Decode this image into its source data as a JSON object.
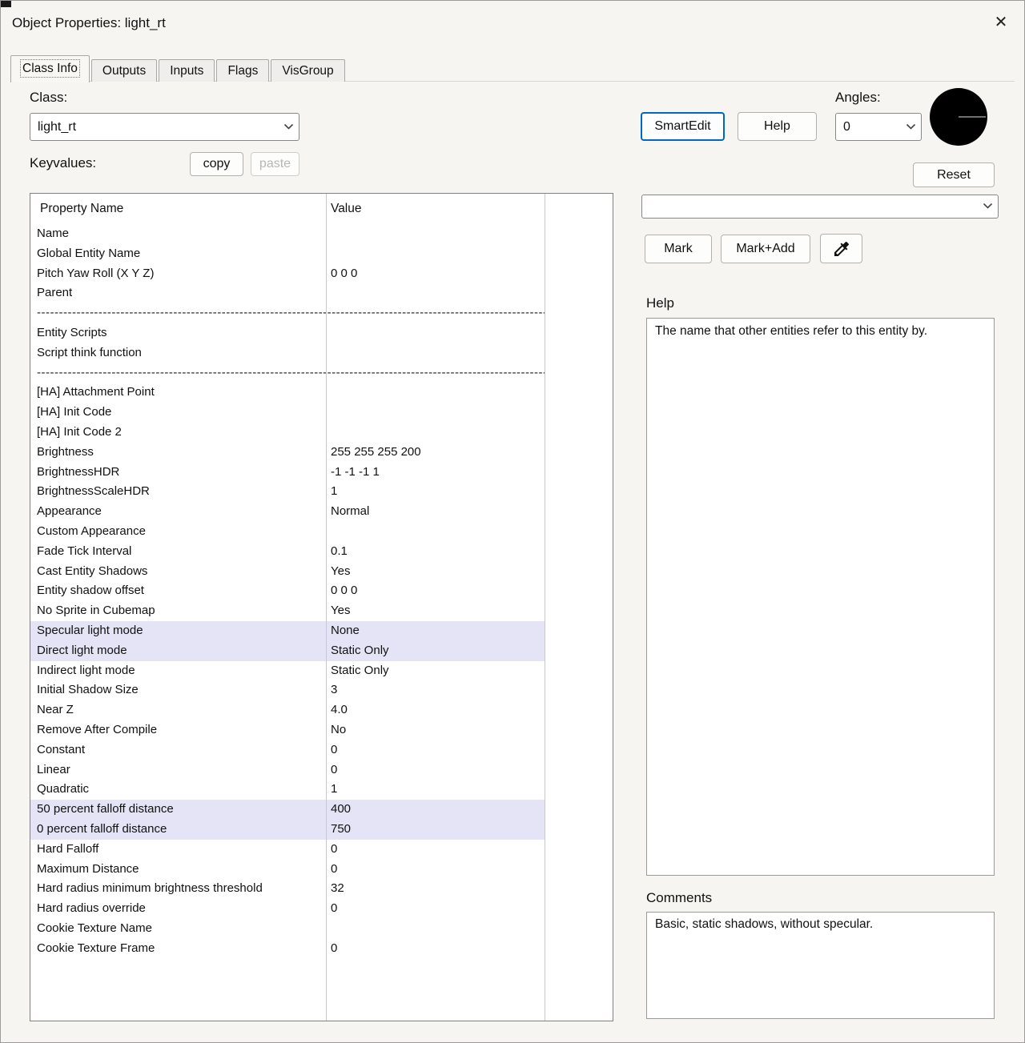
{
  "window": {
    "title": "Object Properties: light_rt"
  },
  "icons": {
    "close": "✕",
    "combo_chevron": "chevron-down",
    "picker": "eyedropper"
  },
  "tabs": [
    {
      "label": "Class Info",
      "active": true
    },
    {
      "label": "Outputs",
      "active": false
    },
    {
      "label": "Inputs",
      "active": false
    },
    {
      "label": "Flags",
      "active": false
    },
    {
      "label": "VisGroup",
      "active": false
    }
  ],
  "class_section": {
    "label": "Class:",
    "value": "light_rt"
  },
  "keyvalues": {
    "label": "Keyvalues:"
  },
  "actions": {
    "smartedit": "SmartEdit",
    "help": "Help",
    "copy": "copy",
    "paste": "paste",
    "reset": "Reset",
    "mark": "Mark",
    "mark_add": "Mark+Add"
  },
  "angles": {
    "label": "Angles:",
    "value": "0"
  },
  "filter": {
    "value": ""
  },
  "table": {
    "headers": [
      "Property Name",
      "Value"
    ],
    "rows": [
      {
        "name": "Name",
        "value": ""
      },
      {
        "name": "Global Entity Name",
        "value": ""
      },
      {
        "name": "Pitch Yaw Roll (X Y Z)",
        "value": "0 0 0"
      },
      {
        "name": "Parent",
        "value": ""
      },
      {
        "name": "------------------------------------------------------------------------------------------------------------------------------------------------------",
        "value": "",
        "divider": true
      },
      {
        "name": "Entity Scripts",
        "value": ""
      },
      {
        "name": "Script think function",
        "value": ""
      },
      {
        "name": "------------------------------------------------------------------------------------------------------------------------------------------------------",
        "value": "",
        "divider": true
      },
      {
        "name": "[HA] Attachment Point",
        "value": ""
      },
      {
        "name": "[HA] Init Code",
        "value": ""
      },
      {
        "name": "[HA] Init Code 2",
        "value": ""
      },
      {
        "name": "Brightness",
        "value": "255 255 255 200"
      },
      {
        "name": "BrightnessHDR",
        "value": "-1 -1 -1 1"
      },
      {
        "name": "BrightnessScaleHDR",
        "value": "1"
      },
      {
        "name": "Appearance",
        "value": "Normal"
      },
      {
        "name": "Custom Appearance",
        "value": ""
      },
      {
        "name": "Fade Tick Interval",
        "value": "0.1"
      },
      {
        "name": "Cast Entity Shadows",
        "value": "Yes"
      },
      {
        "name": "Entity shadow offset",
        "value": "0 0 0"
      },
      {
        "name": "No Sprite in Cubemap",
        "value": "Yes"
      },
      {
        "name": "Specular light mode",
        "value": "None",
        "highlight": true
      },
      {
        "name": "Direct light mode",
        "value": "Static Only",
        "highlight": true
      },
      {
        "name": "Indirect light mode",
        "value": "Static Only"
      },
      {
        "name": "Initial Shadow Size",
        "value": "3"
      },
      {
        "name": "Near Z",
        "value": "4.0"
      },
      {
        "name": "Remove After Compile",
        "value": "No"
      },
      {
        "name": "Constant",
        "value": "0"
      },
      {
        "name": "Linear",
        "value": "0"
      },
      {
        "name": "Quadratic",
        "value": "1"
      },
      {
        "name": "50 percent falloff distance",
        "value": "400",
        "highlight": true
      },
      {
        "name": "0 percent falloff distance",
        "value": "750",
        "highlight": true
      },
      {
        "name": "Hard Falloff",
        "value": "0"
      },
      {
        "name": "Maximum Distance",
        "value": "0"
      },
      {
        "name": "Hard radius minimum brightness threshold",
        "value": "32"
      },
      {
        "name": "Hard radius override",
        "value": "0"
      },
      {
        "name": "Cookie Texture Name",
        "value": ""
      },
      {
        "name": "Cookie Texture Frame",
        "value": "0"
      }
    ]
  },
  "help": {
    "label": "Help",
    "text": "The name that other entities refer to this entity by."
  },
  "comments": {
    "label": "Comments",
    "text": "Basic, static shadows, without specular."
  }
}
